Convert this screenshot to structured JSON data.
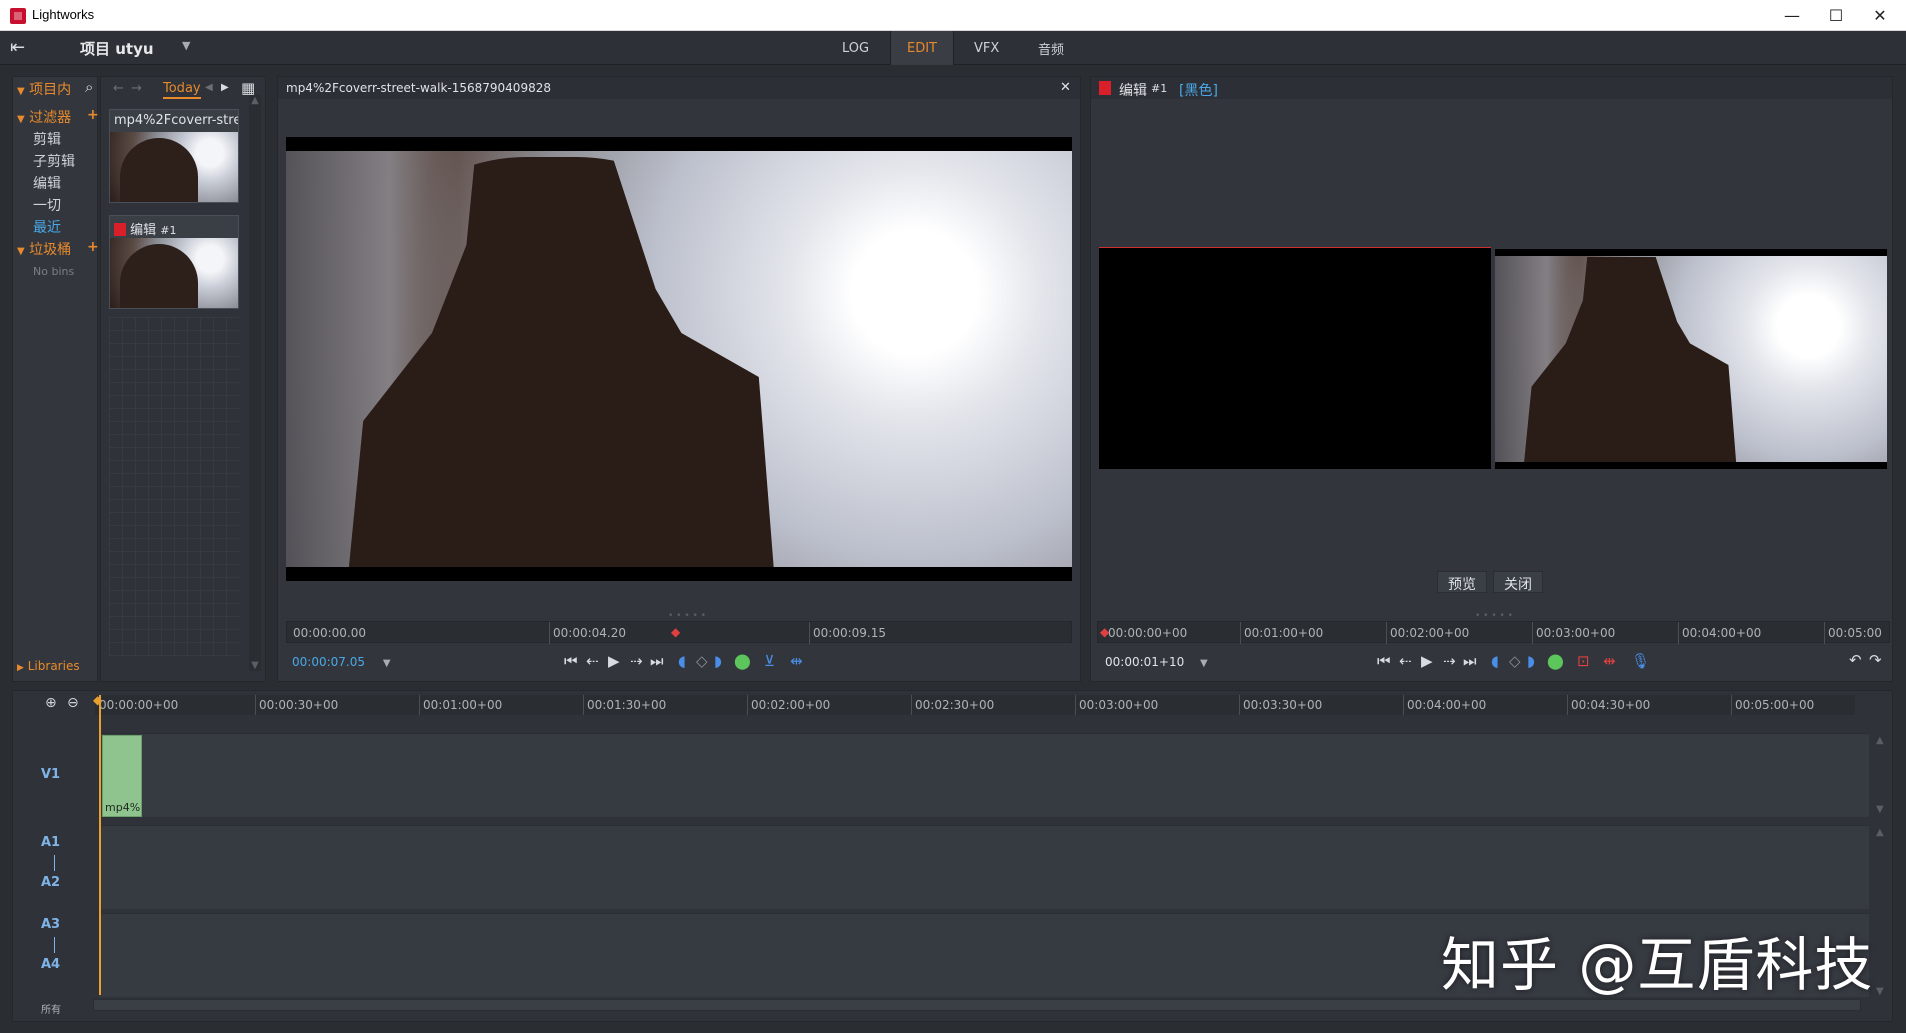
{
  "window": {
    "title": "Lightworks",
    "minimize": "—",
    "maximize": "☐",
    "close": "✕"
  },
  "topbar": {
    "exit_icon": "⇤",
    "project_label": "项目 utyu",
    "project_caret": "▼",
    "tabs": [
      {
        "label": "LOG"
      },
      {
        "label": "EDIT",
        "active": true
      },
      {
        "label": "VFX"
      },
      {
        "label": "音频"
      }
    ]
  },
  "sidebar": {
    "header": "项目内",
    "search_icon": "⌕",
    "filters": {
      "label": "过滤器",
      "add": "+",
      "items": [
        "剪辑",
        "子剪辑",
        "编辑",
        "一切",
        "最近"
      ]
    },
    "trash": {
      "label": "垃圾桶",
      "add": "+",
      "empty": "No bins"
    },
    "libraries": "Libraries"
  },
  "bins": {
    "back": "←",
    "forward": "→",
    "today": "Today",
    "prev": "◀",
    "next": "▶",
    "grid_icon": "▦",
    "cards": [
      {
        "title": "mp4%2Fcoverr-stree"
      },
      {
        "title": "编辑",
        "suffix": "#1"
      }
    ]
  },
  "source": {
    "title": "mp4%2Fcoverr-street-walk-1568790409828",
    "close": "✕",
    "ticks": [
      "00:00:00.00",
      "00:00:04.20",
      "00:00:09.15"
    ],
    "timecode": "00:00:07.05",
    "timecode_caret": "▼"
  },
  "record": {
    "title": "编辑",
    "suffix": "#1",
    "tag": "[黑色]",
    "ticks": [
      "00:00:00+00",
      "00:01:00+00",
      "00:02:00+00",
      "00:03:00+00",
      "00:04:00+00",
      "00:05:00"
    ],
    "timecode": "00:00:01+10",
    "timecode_caret": "▼",
    "preview_button": "预览",
    "close_button": "关闭"
  },
  "timeline": {
    "zoom_in": "⊕",
    "zoom_out": "⊖",
    "ruler": [
      "00:00:00+00",
      "00:00:30+00",
      "00:01:00+00",
      "00:01:30+00",
      "00:02:00+00",
      "00:02:30+00",
      "00:03:00+00",
      "00:03:30+00",
      "00:04:00+00",
      "00:04:30+00",
      "00:05:00+00"
    ],
    "tracks": {
      "v1": "V1",
      "a1": "A1",
      "a2": "A2",
      "a3": "A3",
      "a4": "A4",
      "all": "所有"
    },
    "clip_label": "mp4%"
  },
  "watermark": "知乎 @互盾科技"
}
